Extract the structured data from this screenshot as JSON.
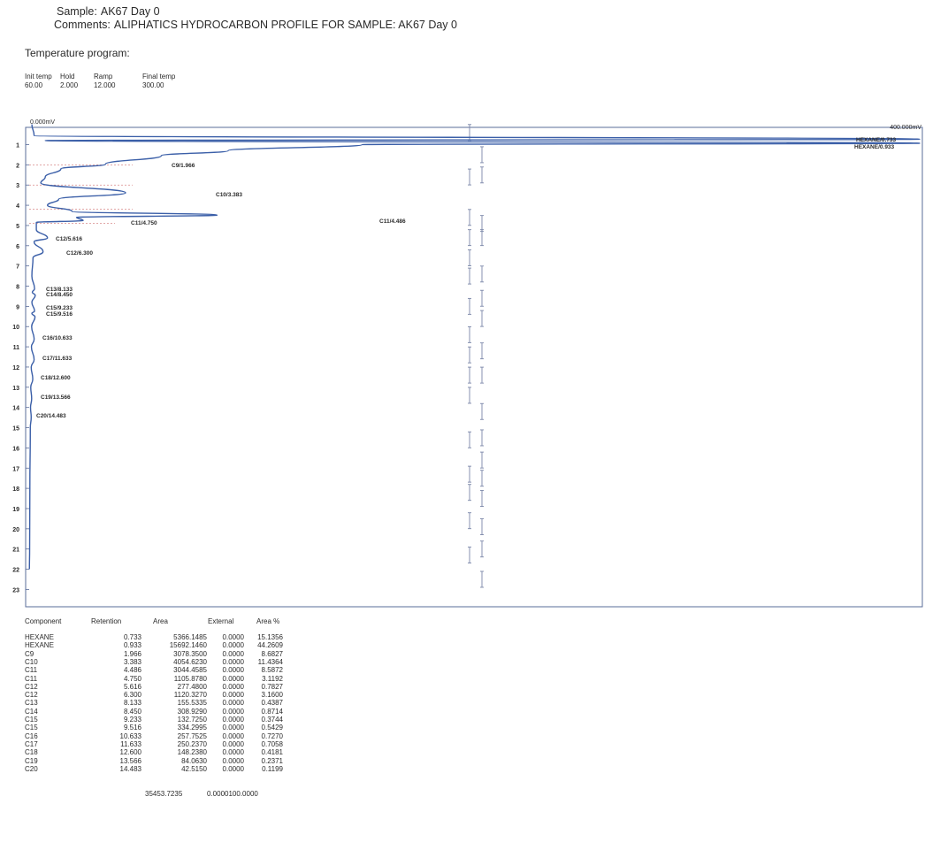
{
  "header": {
    "sample_label": "Sample:",
    "sample_value": "AK67 Day 0",
    "comments_label": "Comments:",
    "comments_value": "ALIPHATICS HYDROCARBON PROFILE FOR SAMPLE: AK67 Day 0"
  },
  "temperature_program": {
    "title": "Temperature program:",
    "columns": [
      {
        "label": "Init temp",
        "value": "60.00"
      },
      {
        "label": "Hold",
        "value": "2.000"
      },
      {
        "label": "Ramp",
        "value": "12.000"
      },
      {
        "label": "Final temp",
        "value": "300.00"
      }
    ]
  },
  "chart_data": {
    "type": "line",
    "orientation": "vertical-time",
    "x_range_label_left": "0.000mV",
    "x_range_label_right": "400.000mV",
    "y_ticks": [
      "1",
      "2",
      "3",
      "4",
      "5",
      "6",
      "7",
      "8",
      "9",
      "10",
      "11",
      "12",
      "13",
      "14",
      "15",
      "16",
      "17",
      "18",
      "19",
      "20",
      "21",
      "22",
      "23"
    ],
    "ylim": [
      0,
      23.5
    ],
    "xlim_mV": [
      0,
      400
    ],
    "grid": false,
    "peak_labels": [
      {
        "text": "HEXANE/0.733",
        "time": 0.733
      },
      {
        "text": "HEXANE/0.933",
        "time": 0.933
      },
      {
        "text": "C9/1.966",
        "time": 1.966
      },
      {
        "text": "C10/3.383",
        "time": 3.383
      },
      {
        "text": "C11/4.486",
        "time": 4.486
      },
      {
        "text": "C11/4.750",
        "time": 4.75
      },
      {
        "text": "C12/5.616",
        "time": 5.616
      },
      {
        "text": "C12/6.300",
        "time": 6.3
      },
      {
        "text": "C13/8.133",
        "time": 8.133
      },
      {
        "text": "C14/8.450",
        "time": 8.45
      },
      {
        "text": "C15/9.233",
        "time": 9.233
      },
      {
        "text": "C15/9.516",
        "time": 9.516
      },
      {
        "text": "C16/10.633",
        "time": 10.633
      },
      {
        "text": "C17/11.633",
        "time": 11.633
      },
      {
        "text": "C18/12.600",
        "time": 12.6
      },
      {
        "text": "C19/13.566",
        "time": 13.566
      },
      {
        "text": "C20/14.483",
        "time": 14.483
      }
    ],
    "trace": [
      [
        0.0,
        2
      ],
      [
        0.55,
        3
      ],
      [
        0.733,
        400
      ],
      [
        0.8,
        8
      ],
      [
        0.933,
        400
      ],
      [
        1.0,
        150
      ],
      [
        1.3,
        90
      ],
      [
        1.55,
        60
      ],
      [
        1.966,
        35
      ],
      [
        2.2,
        15
      ],
      [
        2.6,
        8
      ],
      [
        2.9,
        6
      ],
      [
        3.383,
        44
      ],
      [
        3.7,
        14
      ],
      [
        4.0,
        9
      ],
      [
        4.3,
        20
      ],
      [
        4.486,
        85
      ],
      [
        4.6,
        22
      ],
      [
        4.75,
        25
      ],
      [
        4.85,
        4
      ],
      [
        5.2,
        4
      ],
      [
        5.616,
        9
      ],
      [
        5.8,
        3
      ],
      [
        6.3,
        7
      ],
      [
        6.6,
        2.5
      ],
      [
        7.5,
        2.0
      ],
      [
        8.133,
        3.2
      ],
      [
        8.3,
        2.2
      ],
      [
        8.45,
        3.5
      ],
      [
        8.8,
        2.0
      ],
      [
        9.233,
        3.2
      ],
      [
        9.35,
        2.0
      ],
      [
        9.516,
        3.4
      ],
      [
        10.0,
        1.9
      ],
      [
        10.633,
        3.0
      ],
      [
        11.0,
        1.8
      ],
      [
        11.633,
        3.0
      ],
      [
        12.0,
        1.7
      ],
      [
        12.6,
        2.4
      ],
      [
        13.0,
        1.5
      ],
      [
        13.566,
        1.9
      ],
      [
        14.0,
        1.4
      ],
      [
        14.483,
        1.7
      ],
      [
        15.0,
        1.3
      ],
      [
        18.0,
        1.1
      ],
      [
        21.0,
        1.0
      ],
      [
        22.0,
        0.9
      ]
    ],
    "marker_column": {
      "left": [
        0.4,
        2.6,
        4.6,
        5.6,
        6.6,
        7.5,
        9.0,
        10.4,
        11.4,
        12.4,
        13.4,
        15.6,
        17.3,
        18.2,
        19.6,
        21.3
      ],
      "right": [
        1.5,
        2.5,
        4.9,
        5.6,
        7.4,
        8.6,
        9.6,
        11.2,
        12.4,
        14.2,
        15.5,
        16.6,
        17.5,
        18.5,
        19.9,
        21.0,
        22.5
      ]
    }
  },
  "results": {
    "headers": [
      "Component",
      "Retention",
      "Area",
      "External",
      "Area %"
    ],
    "rows": [
      [
        "HEXANE",
        "0.733",
        "5366.1485",
        "0.0000",
        "15.1356"
      ],
      [
        "HEXANE",
        "0.933",
        "15692.1460",
        "0.0000",
        "44.2609"
      ],
      [
        "C9",
        "1.966",
        "3078.3500",
        "0.0000",
        "8.6827"
      ],
      [
        "C10",
        "3.383",
        "4054.6230",
        "0.0000",
        "11.4364"
      ],
      [
        "C11",
        "4.486",
        "3044.4585",
        "0.0000",
        "8.5872"
      ],
      [
        "C11",
        "4.750",
        "1105.8780",
        "0.0000",
        "3.1192"
      ],
      [
        "C12",
        "5.616",
        "277.4800",
        "0.0000",
        "0.7827"
      ],
      [
        "C12",
        "6.300",
        "1120.3270",
        "0.0000",
        "3.1600"
      ],
      [
        "C13",
        "8.133",
        "155.5335",
        "0.0000",
        "0.4387"
      ],
      [
        "C14",
        "8.450",
        "308.9290",
        "0.0000",
        "0.8714"
      ],
      [
        "C15",
        "9.233",
        "132.7250",
        "0.0000",
        "0.3744"
      ],
      [
        "C15",
        "9.516",
        "334.2995",
        "0.0000",
        "0.5429"
      ],
      [
        "C16",
        "10.633",
        "257.7525",
        "0.0000",
        "0.7270"
      ],
      [
        "C17",
        "11.633",
        "250.2370",
        "0.0000",
        "0.7058"
      ],
      [
        "C18",
        "12.600",
        "148.2380",
        "0.0000",
        "0.4181"
      ],
      [
        "C19",
        "13.566",
        "84.0630",
        "0.0000",
        "0.2371"
      ],
      [
        "C20",
        "14.483",
        "42.5150",
        "0.0000",
        "0.1199"
      ]
    ],
    "total_area": "35453.7235",
    "total_tail": "0.0000100.0000"
  },
  "colors": {
    "trace": "#3b5fa8",
    "frame": "#5a6c9a",
    "baseline_dash": "#d98a8a",
    "marker": "#7a86a8",
    "text": "#2a2a2a"
  }
}
